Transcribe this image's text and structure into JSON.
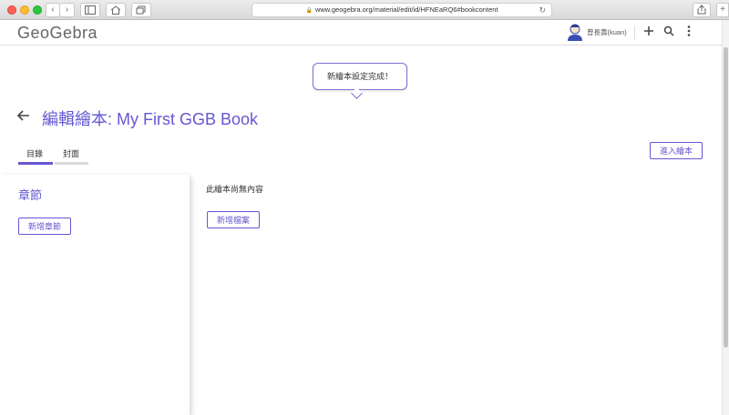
{
  "browser": {
    "url": "www.geogebra.org/material/edit/id/HFNEaRQ6#bookcontent",
    "nav_back": "‹",
    "nav_forward": "›",
    "sidebar_icon": "sidebar-icon",
    "home_icon": "home-icon",
    "tabs_icon": "tabs-icon",
    "share_icon": "share-icon",
    "newtab_icon": "plus-icon"
  },
  "app": {
    "logo": "GeoGebra",
    "user_name": "曾長壽(kuan)",
    "accent_color": "#6557d2"
  },
  "toast": {
    "message": "新繪本設定完成！"
  },
  "page": {
    "back_icon": "arrow-left-icon",
    "title": "編輯繪本: My First GGB Book",
    "tabs": [
      {
        "label": "目錄",
        "active": true
      },
      {
        "label": "封面",
        "active": false
      }
    ],
    "enter_book_label": "進入繪本"
  },
  "chapters": {
    "heading": "章節",
    "add_chapter_label": "新增章節"
  },
  "content": {
    "empty_message": "此繪本尚無內容",
    "add_file_label": "新增檔案"
  }
}
